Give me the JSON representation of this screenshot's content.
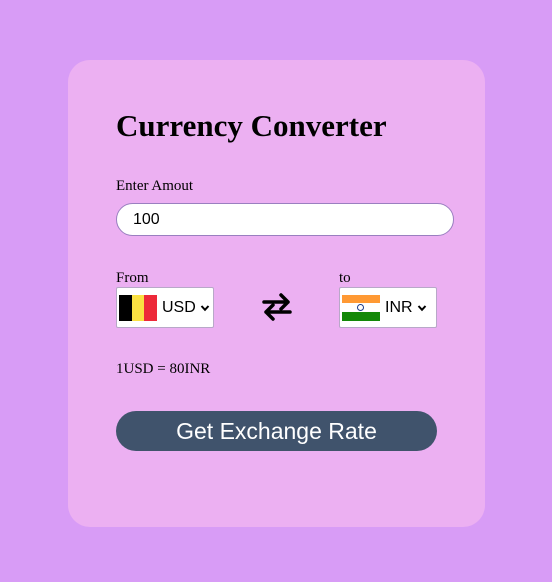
{
  "title": "Currency Converter",
  "amount": {
    "label": "Enter Amout",
    "value": "100"
  },
  "from": {
    "label": "From",
    "currency": "USD",
    "flag_icon": "belgium-flag-icon"
  },
  "to": {
    "label": "to",
    "currency": "INR",
    "flag_icon": "india-flag-icon"
  },
  "swap_icon": "swap-arrows-icon",
  "rate_text": "1USD = 80INR",
  "button_label": "Get Exchange Rate",
  "colors": {
    "page_bg": "#d89cf6",
    "card_bg": "#ecb0f2",
    "button_bg": "#40536c",
    "button_text": "#ffffff"
  }
}
